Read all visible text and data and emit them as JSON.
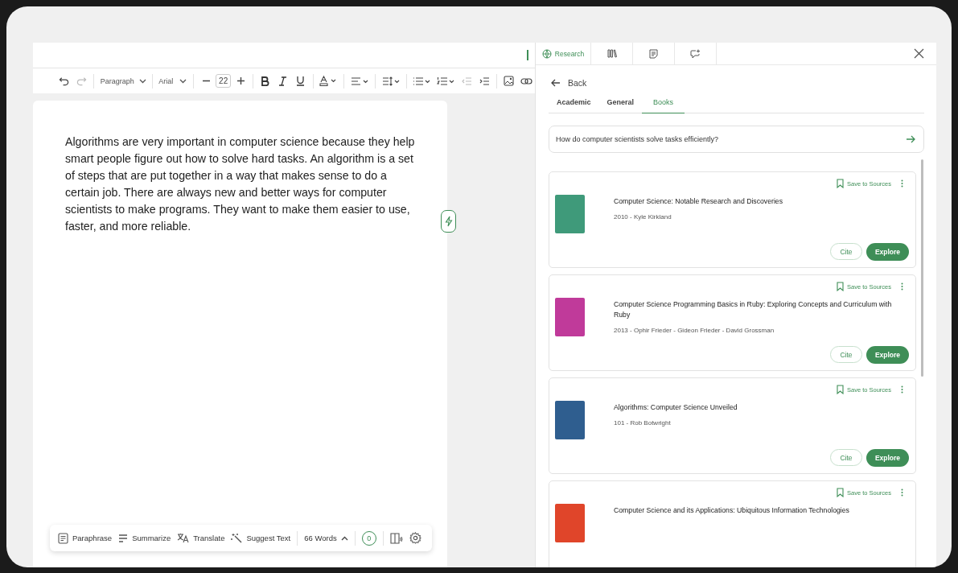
{
  "toolbar": {
    "undo_enabled": true,
    "redo_enabled": false,
    "style": "Paragraph",
    "font": "Arial",
    "size": "22"
  },
  "document": {
    "text": "Algorithms are very important in computer science because they help smart people figure out how to solve hard tasks. An algorithm is a set of steps that are put together in a way that makes sense to do a certain job. There are always new and better ways for computer scientists to make programs. They want to make them easier to use, faster, and more reliable."
  },
  "bottom_bar": {
    "actions": [
      {
        "kind": "paraphrase",
        "label": "Paraphrase"
      },
      {
        "kind": "summarize",
        "label": "Summarize"
      },
      {
        "kind": "translate",
        "label": "Translate"
      },
      {
        "kind": "suggest",
        "label": "Suggest Text"
      }
    ],
    "word_count": "66 Words",
    "score": "0"
  },
  "panel": {
    "tabs": [
      {
        "kind": "research",
        "label": "Research",
        "selected": true
      },
      {
        "kind": "library",
        "selected": false
      },
      {
        "kind": "notes",
        "selected": false
      },
      {
        "kind": "chat",
        "selected": false
      }
    ],
    "back": "Back",
    "source_tabs": [
      {
        "label": "Academic",
        "selected": false
      },
      {
        "label": "General",
        "selected": false
      },
      {
        "label": "Books",
        "selected": true
      }
    ],
    "query": "How do computer scientists solve tasks efficiently?",
    "results": [
      {
        "title": "Computer Science: Notable Research and Discoveries",
        "meta": "2010 - Kyle Kirkland",
        "save": "Save to Sources",
        "cite": "Cite",
        "explore": "Explore",
        "color": "#3f9a7a"
      },
      {
        "title": "Computer Science Programming Basics in Ruby: Exploring Concepts and Curriculum with Ruby",
        "meta": "2013 - Ophir Frieder - Gideon Frieder - David Grossman",
        "save": "Save to Sources",
        "cite": "Cite",
        "explore": "Explore",
        "color": "#c03a9a"
      },
      {
        "title": "Algorithms: Computer Science Unveiled",
        "meta": "101 - Rob Botwright",
        "save": "Save to Sources",
        "cite": "Cite",
        "explore": "Explore",
        "color": "#2f5e8f"
      },
      {
        "title": "Computer Science and its Applications: Ubiquitous Information Technologies",
        "save": "Save to Sources",
        "color": "#e0452a"
      }
    ]
  }
}
